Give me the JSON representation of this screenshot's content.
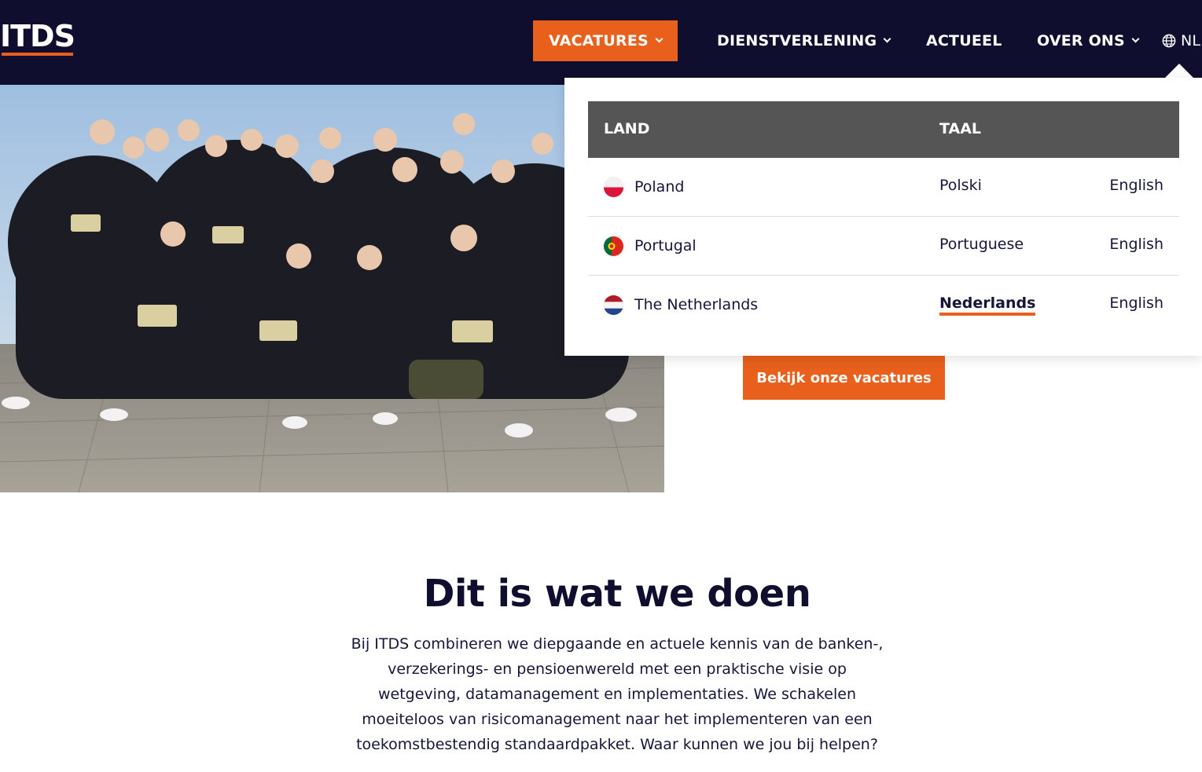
{
  "header": {
    "logo_text": "ITDS",
    "nav": {
      "vacatures": "VACATURES",
      "dienstverlening": "DIENSTVERLENING",
      "actueel": "ACTUEEL",
      "over_ons": "OVER ONS",
      "language": "NL"
    }
  },
  "language_menu": {
    "col_land": "LAND",
    "col_taal": "TAAL",
    "rows": [
      {
        "country": "Poland",
        "lang_local": "Polski",
        "lang_en": "English",
        "flag": "poland-flag"
      },
      {
        "country": "Portugal",
        "lang_local": "Portuguese",
        "lang_en": "English",
        "flag": "portugal-flag"
      },
      {
        "country": "The Netherlands",
        "lang_local": "Nederlands",
        "lang_en": "English",
        "flag": "netherlands-flag",
        "active": true
      }
    ]
  },
  "hero": {
    "image": "team-photo",
    "cta_label": "Bekijk onze vacatures"
  },
  "intro": {
    "title": "Dit is wat we doen",
    "body": "Bij ITDS combineren we diepgaande en actuele kennis van de banken-, verzekerings- en pensioenwereld met een praktische visie op wetgeving, datamanagement en implementaties. We schakelen moeiteloos van risicomanagement naar het implementeren van een toekomstbestendig standaardpakket. Waar kunnen we jou bij helpen?"
  },
  "colors": {
    "navy": "#0f0e2e",
    "accent": "#e8601c",
    "table_header": "#555555"
  }
}
